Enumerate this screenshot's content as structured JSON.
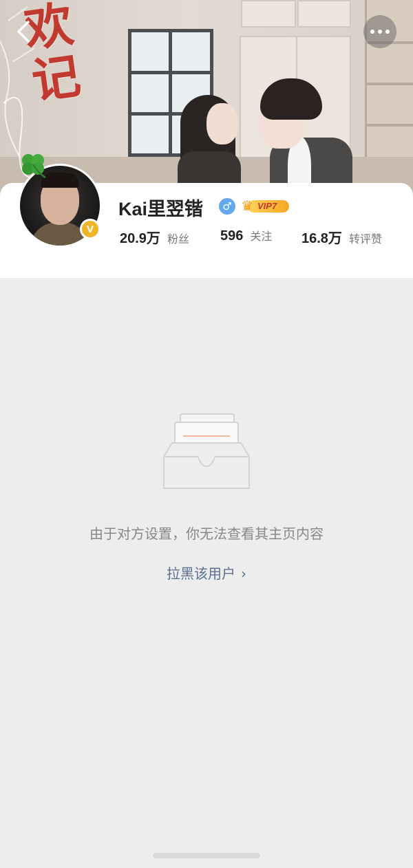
{
  "cover": {
    "welcome_text": "欢记"
  },
  "profile": {
    "username": "Kai里翌锴",
    "gender_symbol": "♂",
    "verify_letter": "V",
    "vip_label": "VIP7"
  },
  "stats": [
    {
      "value": "20.9万",
      "label": "粉丝"
    },
    {
      "value": "596",
      "label": "关注"
    },
    {
      "value": "16.8万",
      "label": "转评赞"
    }
  ],
  "empty_state": {
    "message": "由于对方设置，你无法查看其主页内容",
    "block_link_label": "拉黑该用户",
    "block_link_chevron": "›"
  },
  "colors": {
    "accent_link": "#5b6f8f",
    "verify_badge": "#f0b429",
    "gender_badge": "#62a8ea",
    "background": "#ededed"
  },
  "icons": {
    "back": "back-icon",
    "more": "more-icon",
    "gender": "male-icon",
    "verify": "verified-icon",
    "vip": "vip-crown-icon",
    "empty": "empty-inbox-icon",
    "clover": "clover-icon"
  }
}
